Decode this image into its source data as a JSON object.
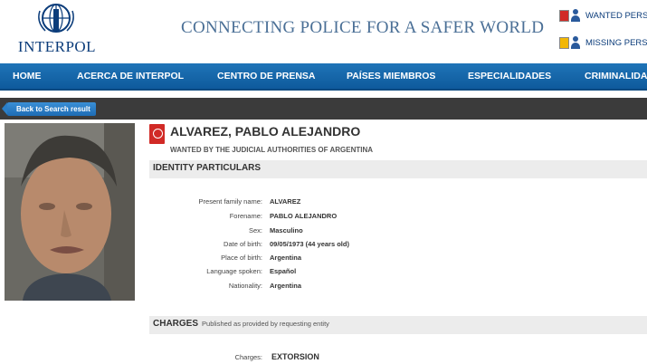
{
  "header": {
    "logo_text": "INTERPOL",
    "slogan": "CONNECTING POLICE FOR A SAFER WORLD",
    "quick_links": [
      {
        "label": "WANTED PERSONS",
        "icon": "wanted-persons-icon"
      },
      {
        "label": "MISSING PERSONS",
        "icon": "missing-persons-icon"
      }
    ]
  },
  "nav": {
    "items": [
      "HOME",
      "ACERCA DE INTERPOL",
      "CENTRO DE PRENSA",
      "PAÍSES MIEMBROS",
      "ESPECIALIDADES",
      "CRIMINALIDAD"
    ]
  },
  "subbar": {
    "back_label": "Back to Search result"
  },
  "notice": {
    "name": "ALVAREZ, PABLO ALEJANDRO",
    "wanted_by": "WANTED BY THE JUDICIAL AUTHORITIES OF ARGENTINA"
  },
  "identity": {
    "title": "IDENTITY PARTICULARS",
    "fields": [
      {
        "label": "Present family name:",
        "value": "ALVAREZ"
      },
      {
        "label": "Forename:",
        "value": "PABLO ALEJANDRO"
      },
      {
        "label": "Sex:",
        "value": "Masculino"
      },
      {
        "label": "Date of birth:",
        "value": "09/05/1973 (44 years old)"
      },
      {
        "label": "Place of birth:",
        "value": "Argentina"
      },
      {
        "label": "Language spoken:",
        "value": "Español"
      },
      {
        "label": "Nationality:",
        "value": "Argentina"
      }
    ]
  },
  "charges": {
    "title": "CHARGES",
    "subtitle": "Published as provided by requesting entity",
    "fields": [
      {
        "label": "Charges:",
        "value": "EXTORSION"
      }
    ]
  },
  "colors": {
    "nav_blue": "#1565a8",
    "logo_blue": "#0b3c7a",
    "notice_red": "#d12a26"
  }
}
